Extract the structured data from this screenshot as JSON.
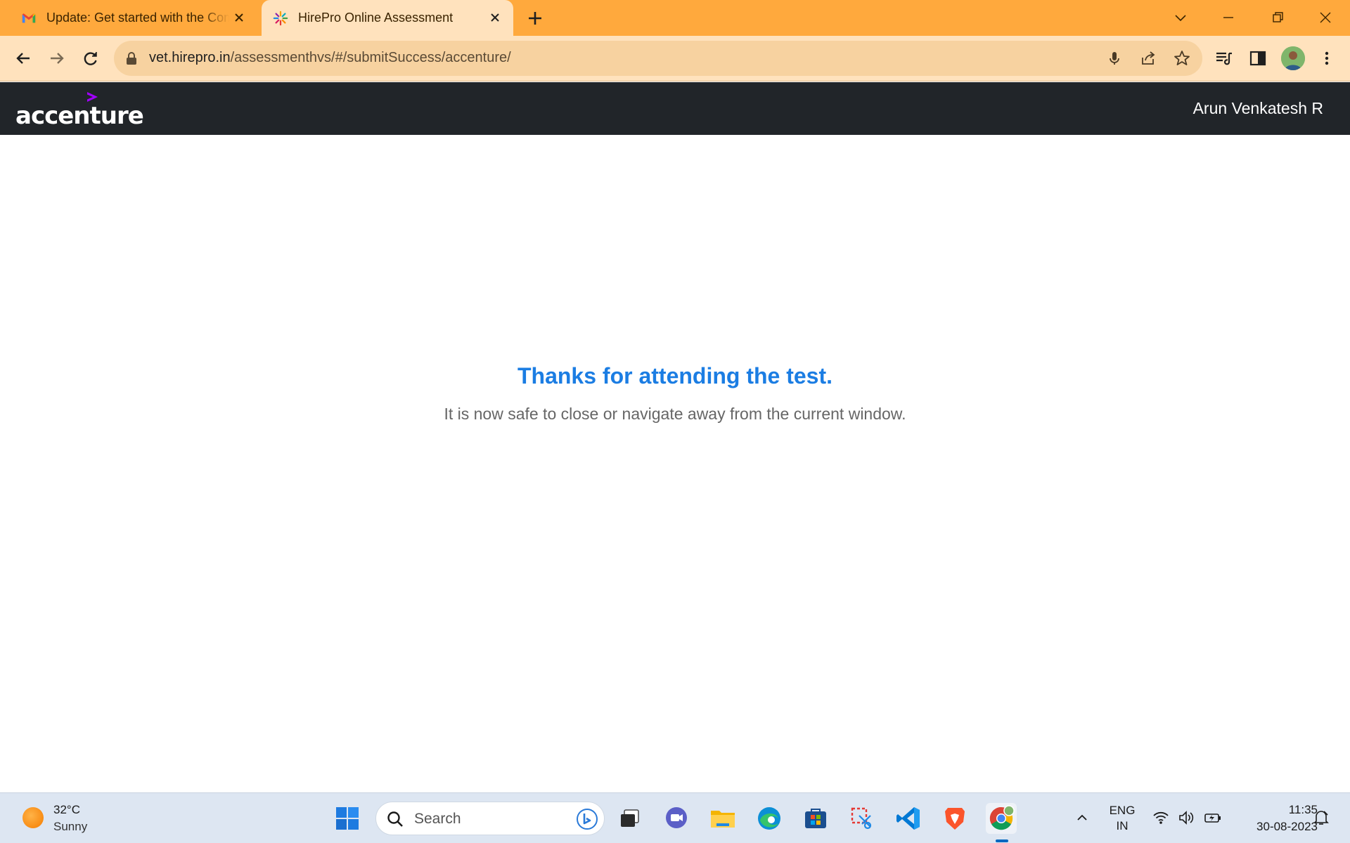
{
  "browser": {
    "tabs": [
      {
        "title": "Update: Get started with the Community",
        "favicon": "gmail-icon",
        "active": false
      },
      {
        "title": "HirePro Online Assessment",
        "favicon": "hirepro-icon",
        "active": true
      }
    ],
    "url_host": "vet.hirepro.in",
    "url_path": "/assessmenthvs/#/submitSuccess/accenture/"
  },
  "site": {
    "logo_text": "accenture",
    "logo_color": "#a100ff",
    "header_bg": "#212529",
    "user_name": "Arun Venkatesh R"
  },
  "main": {
    "heading": "Thanks for attending the test.",
    "message": "It is now safe to close or navigate away from the current window.",
    "heading_color": "#1b7de3"
  },
  "taskbar": {
    "weather_temp": "32°C",
    "weather_condition": "Sunny",
    "search_placeholder": "Search",
    "apps": [
      "windows-start",
      "search",
      "task-view",
      "teams-chat",
      "file-explorer",
      "edge",
      "microsoft-store",
      "snipping-tool",
      "vscode",
      "brave",
      "chrome"
    ],
    "lang_line1": "ENG",
    "lang_line2": "IN",
    "time": "11:35",
    "date": "30-08-2023"
  }
}
